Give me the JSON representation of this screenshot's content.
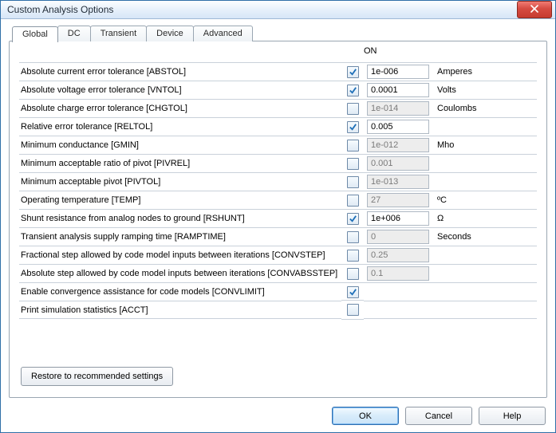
{
  "window": {
    "title": "Custom Analysis Options"
  },
  "tabs": [
    {
      "label": "Global",
      "active": true
    },
    {
      "label": "DC",
      "active": false
    },
    {
      "label": "Transient",
      "active": false
    },
    {
      "label": "Device",
      "active": false
    },
    {
      "label": "Advanced",
      "active": false
    }
  ],
  "columns": {
    "on": "ON"
  },
  "options": [
    {
      "label": "Absolute current error tolerance [ABSTOL]",
      "on": true,
      "value": "1e-006",
      "value_enabled": true,
      "unit": "Amperes"
    },
    {
      "label": "Absolute voltage error tolerance [VNTOL]",
      "on": true,
      "value": "0.0001",
      "value_enabled": true,
      "unit": "Volts"
    },
    {
      "label": "Absolute charge error tolerance [CHGTOL]",
      "on": false,
      "value": "1e-014",
      "value_enabled": false,
      "unit": "Coulombs"
    },
    {
      "label": "Relative error tolerance [RELTOL]",
      "on": true,
      "value": "0.005",
      "value_enabled": true,
      "unit": ""
    },
    {
      "label": "Minimum conductance [GMIN]",
      "on": false,
      "value": "1e-012",
      "value_enabled": false,
      "unit": "Mho"
    },
    {
      "label": "Minimum acceptable ratio of pivot [PIVREL]",
      "on": false,
      "value": "0.001",
      "value_enabled": false,
      "unit": ""
    },
    {
      "label": "Minimum acceptable pivot [PIVTOL]",
      "on": false,
      "value": "1e-013",
      "value_enabled": false,
      "unit": ""
    },
    {
      "label": "Operating temperature [TEMP]",
      "on": false,
      "value": "27",
      "value_enabled": false,
      "unit": "ºC"
    },
    {
      "label": "Shunt resistance from analog nodes to ground [RSHUNT]",
      "on": true,
      "value": "1e+006",
      "value_enabled": true,
      "unit": "Ω"
    },
    {
      "label": "Transient analysis supply ramping time [RAMPTIME]",
      "on": false,
      "value": "0",
      "value_enabled": false,
      "unit": "Seconds"
    },
    {
      "label": "Fractional step allowed by code model inputs between iterations [CONVSTEP]",
      "on": false,
      "value": "0.25",
      "value_enabled": false,
      "unit": ""
    },
    {
      "label": "Absolute step allowed by code model inputs between iterations [CONVABSSTEP]",
      "on": false,
      "value": "0.1",
      "value_enabled": false,
      "unit": ""
    },
    {
      "label": "Enable convergence assistance for code models [CONVLIMIT]",
      "on": true,
      "value": null,
      "value_enabled": false,
      "unit": ""
    },
    {
      "label": "Print simulation statistics [ACCT]",
      "on": false,
      "value": null,
      "value_enabled": false,
      "unit": ""
    }
  ],
  "buttons": {
    "restore": "Restore to recommended settings",
    "ok": "OK",
    "cancel": "Cancel",
    "help": "Help"
  }
}
